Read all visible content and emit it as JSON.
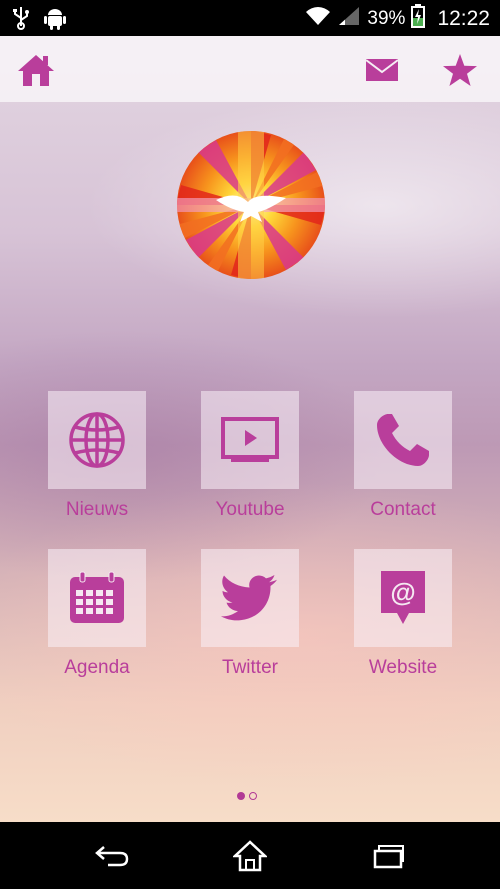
{
  "status_bar": {
    "battery_percent": "39%",
    "time": "12:22",
    "icons": [
      "usb-icon",
      "android-icon",
      "wifi-icon",
      "signal-icon",
      "battery-icon"
    ]
  },
  "topbar": {
    "icons": [
      "home-icon",
      "mail-icon",
      "star-icon"
    ]
  },
  "tiles": [
    {
      "label": "Nieuws",
      "icon": "globe-icon"
    },
    {
      "label": "Youtube",
      "icon": "play-icon"
    },
    {
      "label": "Contact",
      "icon": "phone-icon"
    },
    {
      "label": "Agenda",
      "icon": "calendar-icon"
    },
    {
      "label": "Twitter",
      "icon": "twitter-icon"
    },
    {
      "label": "Website",
      "icon": "at-sign-icon"
    }
  ],
  "pager": {
    "pages": 2,
    "current": 1
  },
  "navbar": {
    "icons": [
      "back-icon",
      "home-icon",
      "recent-apps-icon"
    ]
  },
  "colors": {
    "accent": "#b93e9b",
    "status_bar": "#000000"
  }
}
